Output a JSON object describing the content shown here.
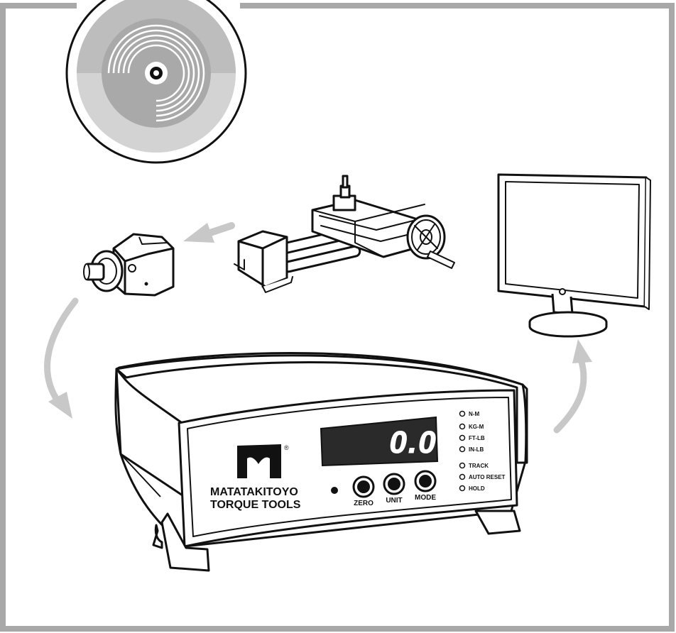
{
  "display": {
    "reading": "0.0"
  },
  "brand": {
    "line1": "MATATAKITOYO",
    "line2": "TORQUE TOOLS",
    "registered": "®"
  },
  "buttons": {
    "zero": "ZERO",
    "unit": "UNIT",
    "mode": "MODE"
  },
  "unit_indicators": [
    "N-M",
    "KG-M",
    "FT-LB",
    "IN-LB"
  ],
  "mode_indicators": [
    "TRACK",
    "AUTO RESET",
    "HOLD"
  ],
  "colors": {
    "frame": "#a8a8a8",
    "arrow": "#c8c8c8",
    "display_bg": "#2a2a2a",
    "display_digits": "#ffffff",
    "outline": "#111111",
    "disc_gray": "#d0d0d0"
  }
}
